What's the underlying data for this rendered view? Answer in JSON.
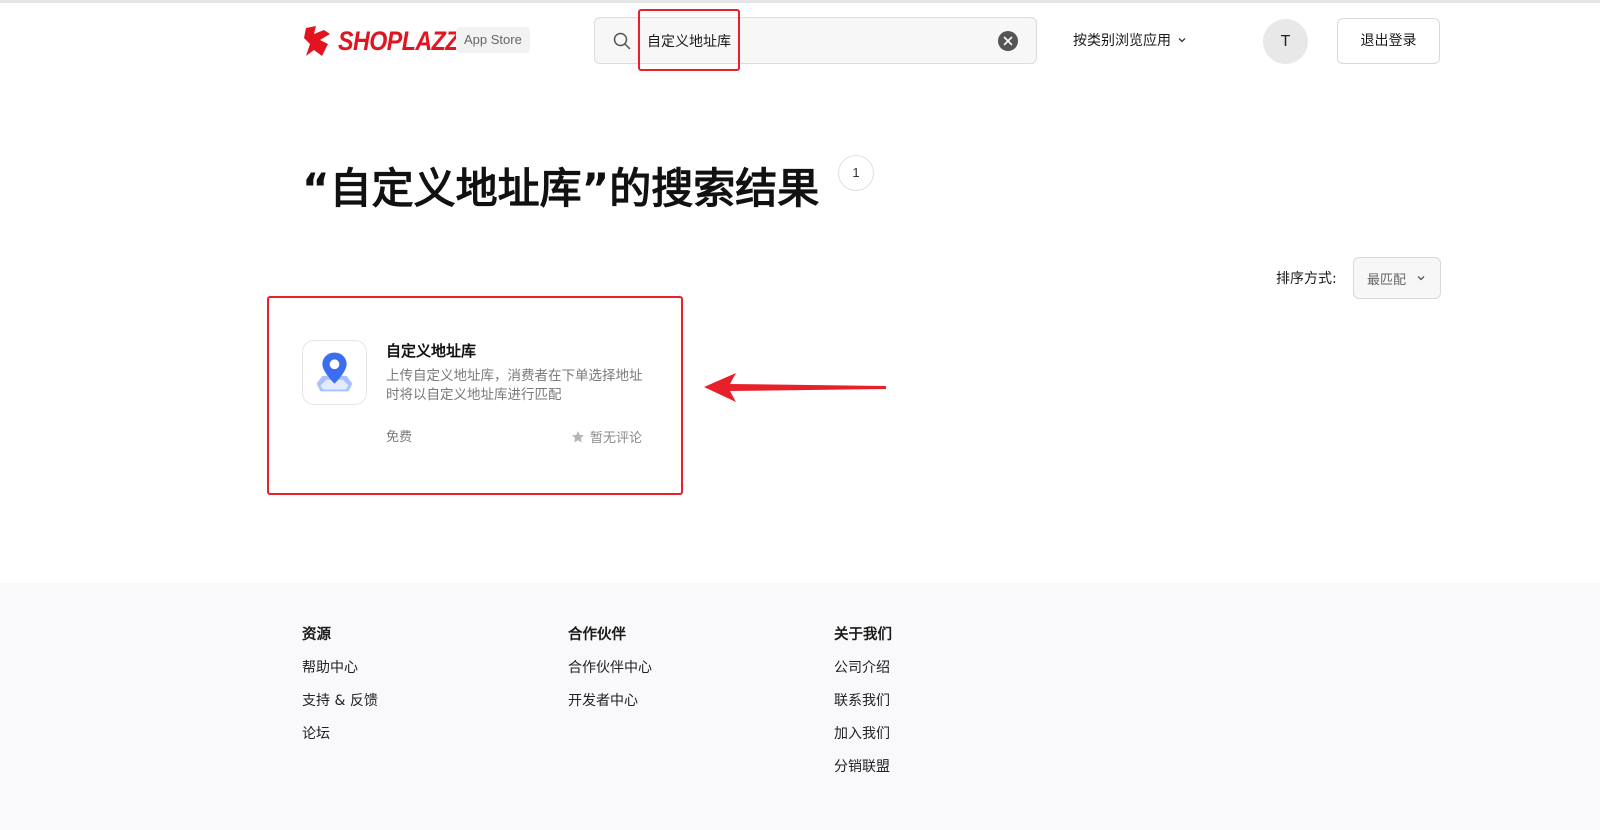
{
  "header": {
    "brand": "SHOPLAZZA",
    "badge": "App Store",
    "search_value": "自定义地址库",
    "browse_label": "按类别浏览应用",
    "avatar_initial": "T",
    "logout_label": "退出登录"
  },
  "results": {
    "title": "“自定义地址库”的搜索结果",
    "count": "1",
    "sort_label": "排序方式:",
    "sort_value": "最匹配"
  },
  "app_card": {
    "name": "自定义地址库",
    "description": "上传自定义地址库，消费者在下单选择地址时将以自定义地址库进行匹配",
    "price": "免费",
    "rating": "暂无评论",
    "icon": "location-pin-icon"
  },
  "footer": {
    "columns": [
      {
        "heading": "资源",
        "links": [
          "帮助中心",
          "支持 & 反馈",
          "论坛"
        ]
      },
      {
        "heading": "合作伙伴",
        "links": [
          "合作伙伴中心",
          "开发者中心"
        ]
      },
      {
        "heading": "关于我们",
        "links": [
          "公司介绍",
          "联系我们",
          "加入我们",
          "分销联盟"
        ]
      }
    ]
  },
  "colors": {
    "brand_red": "#e1141f",
    "annotation_red": "#e8202a",
    "pin_blue": "#3a6df0"
  }
}
